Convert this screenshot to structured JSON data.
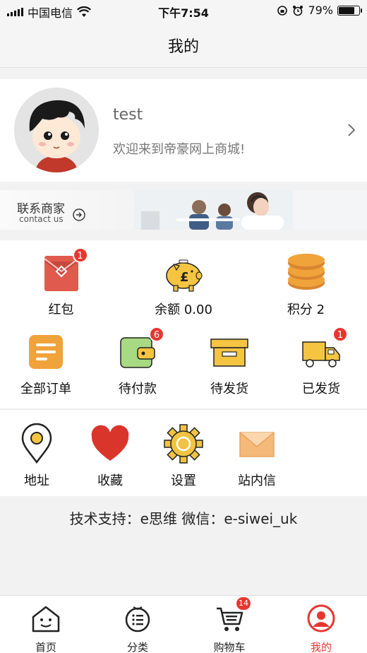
{
  "status_bar": {
    "carrier": "中国电信",
    "time": "下午7:54",
    "battery_percent": "79%",
    "battery_level": 0.79
  },
  "nav": {
    "title": "我的"
  },
  "profile": {
    "username": "test",
    "welcome": "欢迎来到帝豪网上商城!"
  },
  "contact": {
    "title": "联系商家",
    "subtitle": "contact us"
  },
  "wallet": [
    {
      "label": "红包",
      "badge": "1",
      "icon": "red-envelope-icon"
    },
    {
      "label": "余额 0.00",
      "badge": "",
      "icon": "piggy-bank-icon"
    },
    {
      "label": "积分 2",
      "badge": "",
      "icon": "coin-stack-icon"
    }
  ],
  "orders": [
    {
      "label": "全部订单",
      "badge": "",
      "icon": "order-list-icon"
    },
    {
      "label": "待付款",
      "badge": "6",
      "icon": "wallet-icon"
    },
    {
      "label": "待发货",
      "badge": "",
      "icon": "box-icon"
    },
    {
      "label": "已发货",
      "badge": "1",
      "icon": "truck-icon"
    }
  ],
  "tools": [
    {
      "label": "地址",
      "icon": "location-pin-icon"
    },
    {
      "label": "收藏",
      "icon": "heart-icon"
    },
    {
      "label": "设置",
      "icon": "gear-icon"
    },
    {
      "label": "站内信",
      "icon": "envelope-icon"
    }
  ],
  "support": "技术支持：e思维 微信：e-siwei_uk",
  "tabs": [
    {
      "label": "首页",
      "icon": "home-icon",
      "badge": ""
    },
    {
      "label": "分类",
      "icon": "category-icon",
      "badge": ""
    },
    {
      "label": "购物车",
      "icon": "cart-icon",
      "badge": "14"
    },
    {
      "label": "我的",
      "icon": "user-icon",
      "badge": ""
    }
  ],
  "colors": {
    "accent": "#e6372f",
    "icon_orange": "#f0a33a",
    "icon_red": "#e05a4e",
    "icon_yellow": "#f5c542"
  }
}
